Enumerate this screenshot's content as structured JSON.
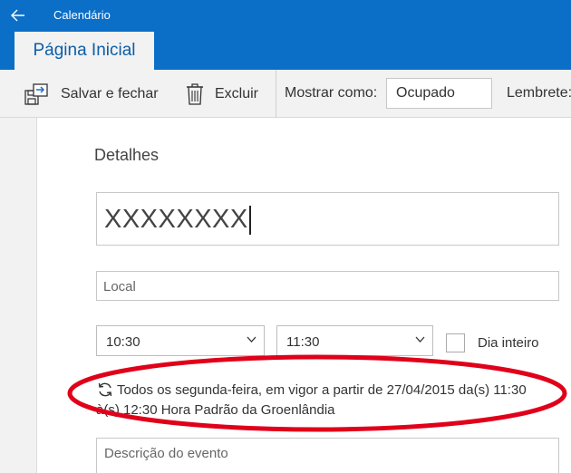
{
  "window": {
    "title": "Calendário",
    "back_icon": "back-arrow-icon"
  },
  "ribbon": {
    "active_tab": "Página Inicial"
  },
  "toolbar": {
    "save_label": "Salvar e fechar",
    "delete_label": "Excluir",
    "show_as_label": "Mostrar como:",
    "show_as_value": "Ocupado",
    "reminder_label": "Lembrete:"
  },
  "details": {
    "heading": "Detalhes",
    "title_value": "XXXXXXXX",
    "location_placeholder": "Local",
    "start_time": "10:30",
    "end_time": "11:30",
    "all_day_label": "Dia inteiro",
    "all_day_checked": false,
    "recurrence_line1": "Todos os segunda-feira, em vigor a partir de 27/04/2015 da(s) 11:30",
    "recurrence_line2": "à(s) 12:30 Hora Padrão da Groenlândia",
    "description_placeholder": "Descrição do evento"
  },
  "colors": {
    "titlebar_blue": "#0b6ec7",
    "tab_text_blue": "#0b5ea8",
    "highlight_red": "#e0001a",
    "toolbar_icon_blue": "#1e6fc8"
  }
}
